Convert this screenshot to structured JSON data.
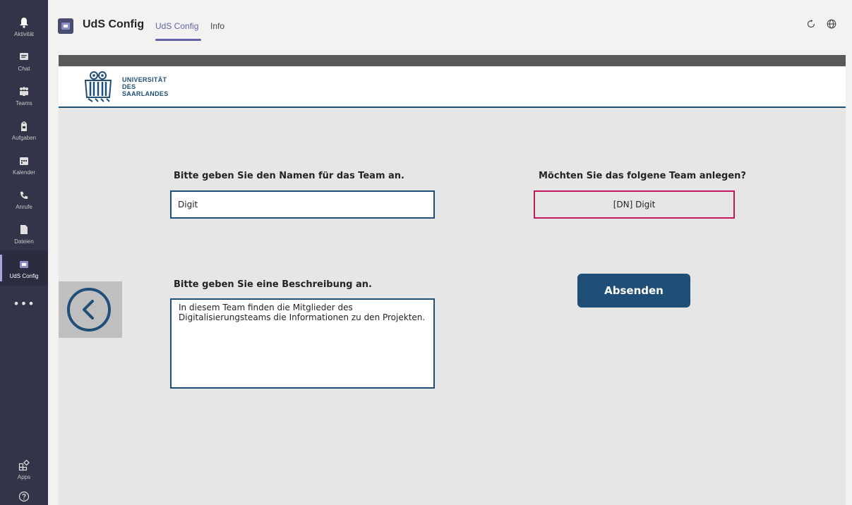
{
  "rail": {
    "items": [
      {
        "label": "Aktivität",
        "icon": "bell-icon"
      },
      {
        "label": "Chat",
        "icon": "chat-icon"
      },
      {
        "label": "Teams",
        "icon": "teams-icon"
      },
      {
        "label": "Aufgaben",
        "icon": "tasks-icon"
      },
      {
        "label": "Kalender",
        "icon": "calendar-icon"
      },
      {
        "label": "Anrufe",
        "icon": "phone-icon"
      },
      {
        "label": "Dateien",
        "icon": "file-icon"
      },
      {
        "label": "UdS Config",
        "icon": "uds-app-icon"
      }
    ],
    "more": "•••",
    "apps_label": "Apps"
  },
  "header": {
    "app_title": "UdS Config",
    "tabs": [
      {
        "label": "UdS Config"
      },
      {
        "label": "Info"
      }
    ]
  },
  "brand": {
    "line1": "UNIVERSITÄT",
    "line2": "DES",
    "line3": "SAARLANDES",
    "color": "#1f4e79"
  },
  "form": {
    "name_label": "Bitte geben Sie den Namen für das Team an.",
    "name_value": "Digit",
    "description_label": "Bitte geben Sie eine Beschreibung an.",
    "description_value": "In diesem Team finden die Mitglieder des Digitalisierungsteams die Informationen zu den Projekten.",
    "confirm_label": "Möchten Sie das folgene Team anlegen?",
    "preview_value": "[DN] Digit",
    "submit_label": "Absenden"
  },
  "colors": {
    "rail_bg": "#33344a",
    "accent": "#6264a7",
    "primary": "#1f4e79",
    "preview_border": "#c2185b"
  }
}
